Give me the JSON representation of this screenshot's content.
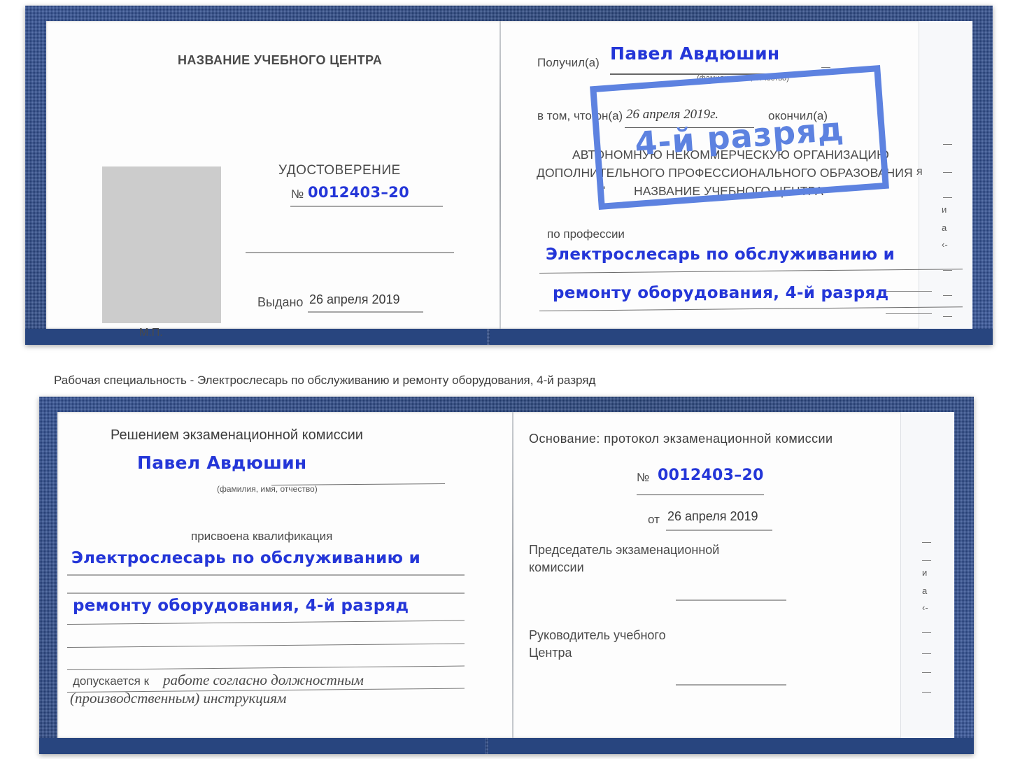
{
  "document": {
    "kind": "Удостоверение (рабочая специальность) — развороты 1 и 2",
    "accent_color": "#5d82e0",
    "cover_color": "#2f4f96",
    "ink_color": "#2436d8"
  },
  "caption": {
    "text": "Рабочая специальность - Электрослесарь по обслуживанию и ремонту оборудования, 4-й разряд"
  },
  "spread1": {
    "left_page": {
      "center_name": "НАЗВАНИЕ УЧЕБНОГО ЦЕНТРА",
      "title": "УДОСТОВЕРЕНИЕ",
      "number_label": "№",
      "number_value": "0012403–20",
      "issued_label": "Выдано",
      "issued_value": "26 апреля 2019",
      "seal_label": "М.П."
    },
    "right_page": {
      "received_label": "Получил(а)",
      "received_value": "Павел Авдюшин",
      "received_hint": "(фамилия, имя, отчество)",
      "in_that_label": "в том, что он(а)",
      "in_that_value": "26 апреля 2019г.",
      "finished_label": "окончил(а)",
      "org_line1": "АВТОНОМНУЮ НЕКОММЕРЧЕСКУЮ ОРГАНИЗАЦИЮ",
      "org_line2": "ДОПОЛНИТЕЛЬНОГО ПРОФЕССИОНАЛЬНОГО ОБРАЗОВАНИЯ",
      "org_quote_open": "\"",
      "org_line3": "НАЗВАНИЕ УЧЕБНОГО ЦЕНТРА",
      "org_quote_close": "\"",
      "profession_label": "по профессии",
      "profession_line1": "Электрослесарь по обслуживанию и",
      "profession_line2": "ремонту оборудования, 4-й разряд"
    },
    "watermark": {
      "text": "4-й разряд"
    },
    "back_page_fragments": [
      "я",
      "и",
      "а",
      "‹-"
    ]
  },
  "spread2": {
    "left_page": {
      "heading": "Решением экзаменационной комиссии",
      "name_value": "Павел Авдюшин",
      "name_hint": "(фамилия, имя, отчество)",
      "qualification_label": "присвоена квалификация",
      "qualification_line1": "Электрослесарь по обслуживанию и",
      "qualification_line2": "ремонту оборудования, 4-й разряд",
      "admitted_label": "допускается к",
      "admitted_line1": "работе согласно должностным",
      "admitted_line2": "(производственным) инструкциям"
    },
    "right_page": {
      "basis_label": "Основание: протокол экзаменационной комиссии",
      "number_label": "№",
      "number_value": "0012403–20",
      "date_label": "от",
      "date_value": "26 апреля 2019",
      "chairman_line1": "Председатель экзаменационной",
      "chairman_line2": "комиссии",
      "head_line1": "Руководитель учебного",
      "head_line2": "Центра"
    },
    "back_page_fragments": [
      "и",
      "а",
      "‹-"
    ]
  }
}
